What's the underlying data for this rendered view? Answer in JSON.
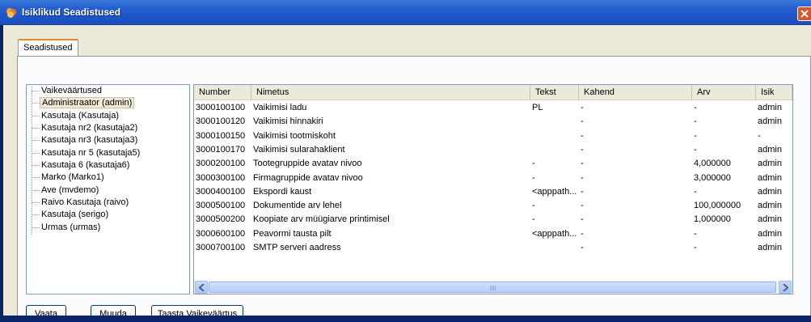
{
  "window": {
    "title": "Isiklikud Seadistused"
  },
  "tab": {
    "label": "Seadistused"
  },
  "tree": {
    "items": [
      "Vaikeväärtused",
      "Administraator (admin)",
      "Kasutaja (Kasutaja)",
      "Kasutaja nr2 (kasutaja2)",
      "Kasutaja nr3 (kasutaja3)",
      "Kasutaja nr 5 (kasutaja5)",
      "Kasutaja 6 (kasutaja6)",
      "Marko (Marko1)",
      "Ave (mvdemo)",
      "Raivo Kasutaja (raivo)",
      "Kasutaja (serigo)",
      "Urmas (urmas)"
    ],
    "selected_index": 1
  },
  "grid": {
    "columns": [
      "Number",
      "Nimetus",
      "Tekst",
      "Kahend",
      "Arv",
      "Isik"
    ],
    "rows": [
      [
        "3000100100",
        "Vaikimisi ladu",
        "PL",
        "-",
        "-",
        "admin"
      ],
      [
        "3000100120",
        "Vaikimisi hinnakiri",
        "",
        "-",
        "-",
        "admin"
      ],
      [
        "3000100150",
        "Vaikimisi tootmiskoht",
        "",
        "-",
        "-",
        "-"
      ],
      [
        "3000100170",
        "Vaikimisi sularahaklient",
        "",
        "-",
        "-",
        "admin"
      ],
      [
        "3000200100",
        "Tootegruppide avatav nivoo",
        "-",
        "-",
        "4,000000",
        "admin"
      ],
      [
        "3000300100",
        "Firmagruppide avatav nivoo",
        "-",
        "-",
        "3,000000",
        "admin"
      ],
      [
        "3000400100",
        "Ekspordi kaust",
        "<apppath...",
        "-",
        "-",
        "admin"
      ],
      [
        "3000500100",
        "Dokumentide arv lehel",
        "-",
        "-",
        "100,000000",
        "admin"
      ],
      [
        "3000500200",
        "Koopiate arv müügiarve printimisel",
        "-",
        "-",
        "1,000000",
        "admin"
      ],
      [
        "3000600100",
        "Peavormi tausta pilt",
        "<apppath...",
        "-",
        "-",
        "admin"
      ],
      [
        "3000700100",
        "SMTP serveri aadress",
        "",
        "-",
        "-",
        "admin"
      ]
    ]
  },
  "buttons": {
    "view": "Vaata",
    "edit": "Muuda",
    "reset": "Taasta Vaikeväärtus"
  },
  "colors": {
    "titlebar": "#2660d0",
    "client": "#ece9d8",
    "tab_accent": "#e68b2c",
    "close": "#d8552f"
  }
}
